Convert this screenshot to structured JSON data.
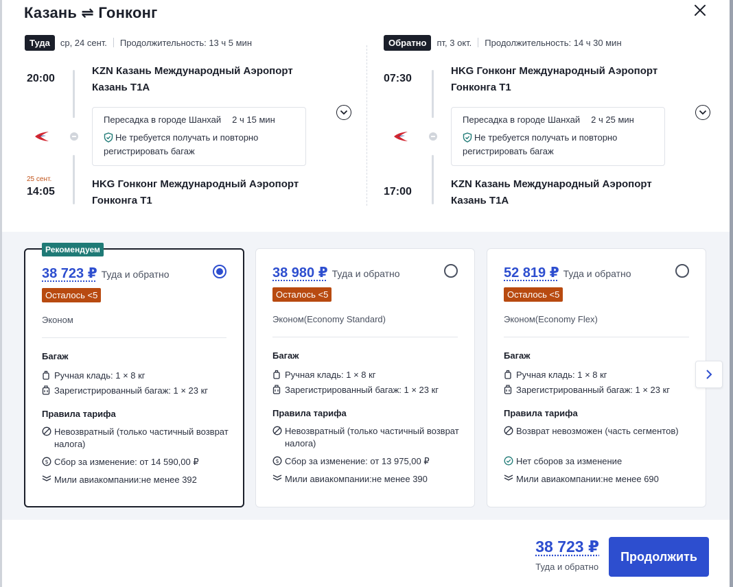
{
  "header": {
    "origin": "Казань",
    "destination": "Гонконг",
    "title": "Казань ⇌ Гонконг",
    "close_icon": "close-icon"
  },
  "outbound": {
    "badge": "Туда",
    "date": "ср, 24 сент.",
    "duration": "Продолжительность: 13 ч 5 мин",
    "dep_time": "20:00",
    "dep_airport_line1": "KZN Казань Международный Аэропорт",
    "dep_airport_line2": "Казань T1A",
    "layover_city": "Пересадка в городе Шанхай",
    "layover_duration": "2 ч 15 мин",
    "baggage_note": "Не требуется получать и повторно регистрировать багаж",
    "arr_nextday": "25 сент.",
    "arr_time": "14:05",
    "arr_airport_line1": "HKG Гонконг Международный Аэропорт",
    "arr_airport_line2": "Гонконга T1"
  },
  "return": {
    "badge": "Обратно",
    "date": "пт, 3 окт.",
    "duration": "Продолжительность: 14 ч 30 мин",
    "dep_time": "07:30",
    "dep_airport_line1": "HKG Гонконг Международный Аэропорт",
    "dep_airport_line2": "Гонконга T1",
    "layover_city": "Пересадка в городе Шанхай",
    "layover_duration": "2 ч 25 мин",
    "baggage_note": "Не требуется получать и повторно регистрировать багаж",
    "arr_time": "17:00",
    "arr_airport_line1": "KZN Казань Международный Аэропорт",
    "arr_airport_line2": "Казань T1A"
  },
  "fares": [
    {
      "recommended_tag": "Рекомендуем",
      "price": "38 723 ₽",
      "price_note": "Туда и обратно",
      "selected": true,
      "availability": "Осталось <5",
      "cabin": "Эконом",
      "baggage_title": "Багаж",
      "hand_luggage": "Ручная кладь: 1 × 8 кг",
      "checked_baggage": "Зарегистрированный багаж: 1 × 23 кг",
      "rules_title": "Правила тарифа",
      "refund": "Невозвратный (только частичный возврат налога)",
      "change_fee": "Сбор за изменение: от 14 590,00 ₽",
      "miles": "Мили авиакомпании:не менее 392"
    },
    {
      "price": "38 980 ₽",
      "price_note": "Туда и обратно",
      "selected": false,
      "availability": "Осталось <5",
      "cabin": "Эконом(Economy Standard)",
      "baggage_title": "Багаж",
      "hand_luggage": "Ручная кладь: 1 × 8 кг",
      "checked_baggage": "Зарегистрированный багаж: 1 × 23 кг",
      "rules_title": "Правила тарифа",
      "refund": "Невозвратный (только частичный возврат налога)",
      "change_fee": "Сбор за изменение: от 13 975,00 ₽",
      "miles": "Мили авиакомпании:не менее 390"
    },
    {
      "price": "52 819 ₽",
      "price_note": "Туда и обратно",
      "selected": false,
      "availability": "Осталось <5",
      "cabin": "Эконом(Economy Flex)",
      "baggage_title": "Багаж",
      "hand_luggage": "Ручная кладь: 1 × 8 кг",
      "checked_baggage": "Зарегистрированный багаж: 1 × 23 кг",
      "rules_title": "Правила тарифа",
      "refund": "Возврат невозможен (часть сегментов)",
      "change_fee": "Нет сборов за изменение",
      "miles": "Мили авиакомпании:не менее 690"
    }
  ],
  "footer": {
    "total_price": "38 723 ₽",
    "total_note": "Туда и обратно",
    "continue_label": "Продолжить"
  },
  "colors": {
    "accent": "#2d4ecf",
    "badge_dark": "#1b1f2a",
    "availability": "#b84a10",
    "recommended": "#1f7a76",
    "nextday": "#c0531a"
  }
}
